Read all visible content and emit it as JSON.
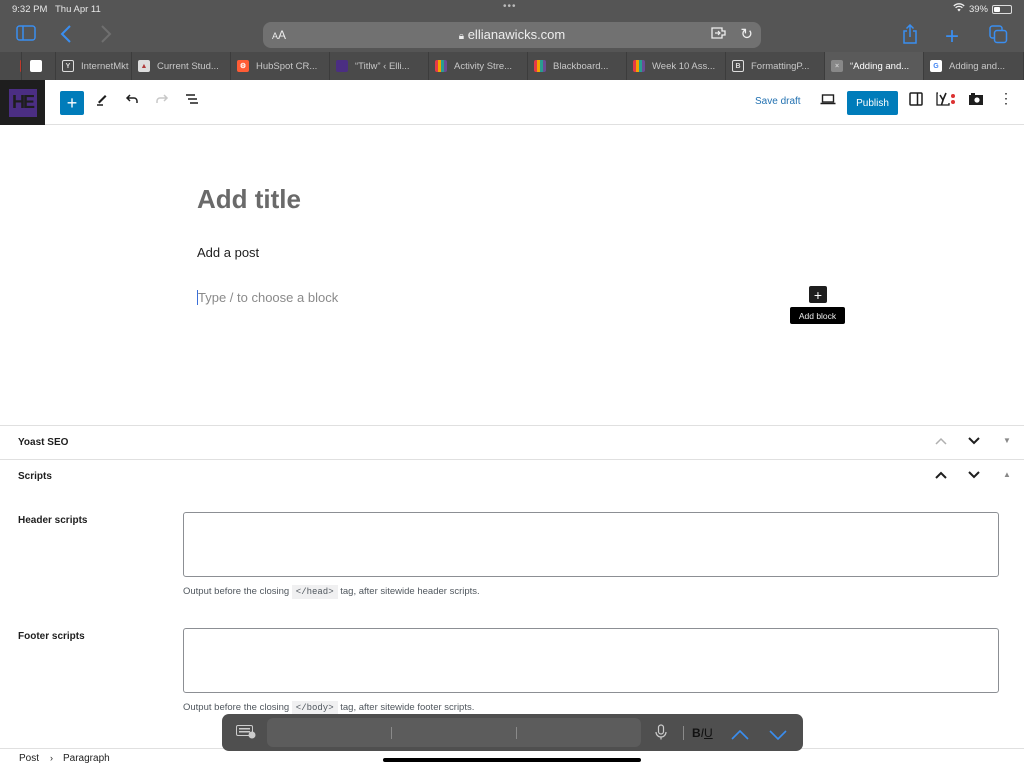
{
  "status_bar": {
    "time": "9:32 PM",
    "date": "Thu Apr 11",
    "battery_percent": "39%",
    "battery_level": 0.39
  },
  "browser": {
    "text_size_label": "AA",
    "url": "ellianawicks.com",
    "tabs": [
      {
        "label": "",
        "icon": "pinned-red-icon",
        "color": "#c0392b"
      },
      {
        "label": "",
        "icon": "page-icon",
        "color": "#ffffff"
      },
      {
        "label": "InternetMkt",
        "icon": "y-icon",
        "color": "#dddddd"
      },
      {
        "label": "Current Stud...",
        "icon": "school-icon",
        "color": "#b03a3a"
      },
      {
        "label": "HubSpot CR...",
        "icon": "hubspot-icon",
        "color": "#ff5c35"
      },
      {
        "label": "“Titlw” ‹ Elli...",
        "icon": "site-icon",
        "color": "#4b2e83"
      },
      {
        "label": "Activity Stre...",
        "icon": "bar-chart-icon",
        "color": "#e8a317"
      },
      {
        "label": "Blackboard...",
        "icon": "bar-chart-icon",
        "color": "#e8a317"
      },
      {
        "label": "Week 10 Ass...",
        "icon": "bar-chart-icon",
        "color": "#e8a317"
      },
      {
        "label": "FormattingP...",
        "icon": "b-icon",
        "color": "#dddddd"
      },
      {
        "label": "“Adding and...",
        "icon": "close-tab-icon",
        "color": "#888888",
        "active": true
      },
      {
        "label": "Adding and...",
        "icon": "google-icon",
        "color": "#4285f4"
      }
    ]
  },
  "wp_header": {
    "logo_text": "HE",
    "save_draft": "Save draft",
    "publish": "Publish"
  },
  "editor": {
    "title_placeholder": "Add title",
    "paragraph": "Add a post",
    "block_placeholder": "Type / to choose a block",
    "add_block_tooltip": "Add block",
    "add_block_symbol": "+"
  },
  "metaboxes": {
    "yoast": {
      "title": "Yoast SEO"
    },
    "scripts": {
      "title": "Scripts",
      "header_label": "Header scripts",
      "header_value": "",
      "header_help_pre": "Output before the closing ",
      "header_help_code": "</head>",
      "header_help_post": " tag, after sitewide header scripts.",
      "footer_label": "Footer scripts",
      "footer_value": "",
      "footer_help_pre": "Output before the closing ",
      "footer_help_code": "</body>",
      "footer_help_post": " tag, after sitewide footer scripts."
    }
  },
  "breadcrumbs": {
    "root": "Post",
    "separator": "›",
    "current": "Paragraph"
  },
  "keyboard_bar": {
    "format_label": "BIU"
  }
}
